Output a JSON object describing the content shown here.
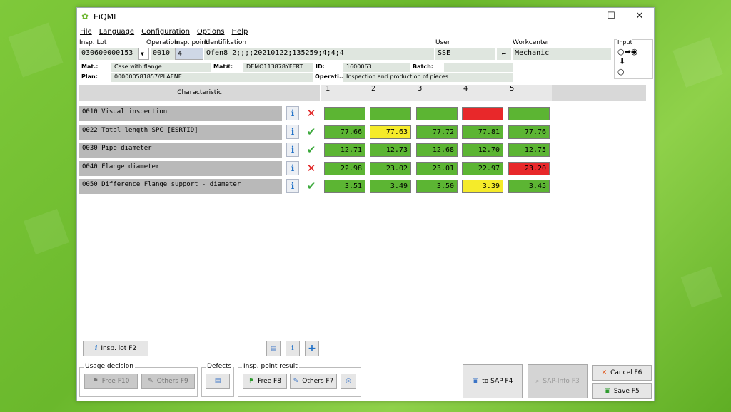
{
  "window": {
    "title": "EiQMI",
    "minimize": "—",
    "maximize": "☐",
    "close": "✕"
  },
  "menu": [
    "File",
    "Language",
    "Configuration",
    "Options",
    "Help"
  ],
  "header": {
    "insp_lot_label": "Insp. Lot",
    "insp_lot_value": "030600000153",
    "operation_label": "Operation",
    "operation_value": "0010",
    "insp_point_label": "Insp. point",
    "insp_point_value": "4",
    "ident_label": "Identifikation",
    "ident_value": "Ofen8 2;;;;20210122;135259;4;4;4",
    "user_label": "User",
    "user_value": "SSE",
    "workcenter_label": "Workcenter",
    "workcenter_value": "Mechanic",
    "input_label": "Input"
  },
  "details": {
    "mat_label": "Mat.:",
    "mat_value": "Case with flange",
    "matnr_label": "Mat#:",
    "matnr_value": "DEMO113878YFERT",
    "id_label": "ID:",
    "id_value": "1600063",
    "batch_label": "Batch:",
    "batch_value": "",
    "plan_label": "Plan:",
    "plan_value": "000000581857/PLAENE",
    "operati_label": "Operati...",
    "operati_value": "Inspection and production of pieces"
  },
  "grid": {
    "characteristic_header": "Characteristic",
    "columns": [
      "1",
      "2",
      "3",
      "4",
      "5"
    ],
    "rows": [
      {
        "name": "0010 Visual inspection",
        "status": "fail",
        "values": [
          "",
          "",
          "",
          "",
          ""
        ],
        "colors": [
          "green",
          "green",
          "green",
          "red",
          "green"
        ]
      },
      {
        "name": "0022 Total length SPC [ESRTID]",
        "status": "ok",
        "values": [
          "77.66",
          "77.63",
          "77.72",
          "77.81",
          "77.76"
        ],
        "colors": [
          "green",
          "yellow",
          "green",
          "green",
          "green"
        ]
      },
      {
        "name": "0030 Pipe diameter",
        "status": "ok",
        "values": [
          "12.71",
          "12.73",
          "12.68",
          "12.70",
          "12.75"
        ],
        "colors": [
          "green",
          "green",
          "green",
          "green",
          "green"
        ]
      },
      {
        "name": "0040 Flange diameter",
        "status": "fail",
        "values": [
          "22.98",
          "23.02",
          "23.01",
          "22.97",
          "23.20"
        ],
        "colors": [
          "green",
          "green",
          "green",
          "green",
          "red"
        ]
      },
      {
        "name": "0050 Difference Flange support - diameter",
        "status": "ok",
        "values": [
          "3.51",
          "3.49",
          "3.50",
          "3.39",
          "3.45"
        ],
        "colors": [
          "green",
          "green",
          "green",
          "yellow",
          "green"
        ]
      }
    ]
  },
  "buttons": {
    "insp_lot": "Insp. lot  F2",
    "usage_decision_title": "Usage decision",
    "free_f10": "Free  F10",
    "others_f9": "Others  F9",
    "defects_title": "Defects",
    "insp_point_result_title": "Insp. point result",
    "free_f8": "Free  F8",
    "others_f7": "Others  F7",
    "to_sap": "to SAP  F4",
    "sap_info": "SAP-Info  F3",
    "cancel": "Cancel  F6",
    "save": "Save  F5"
  },
  "colors": {
    "green": "#5cb533",
    "yellow": "#f5eb2a",
    "red": "#e8282a"
  }
}
